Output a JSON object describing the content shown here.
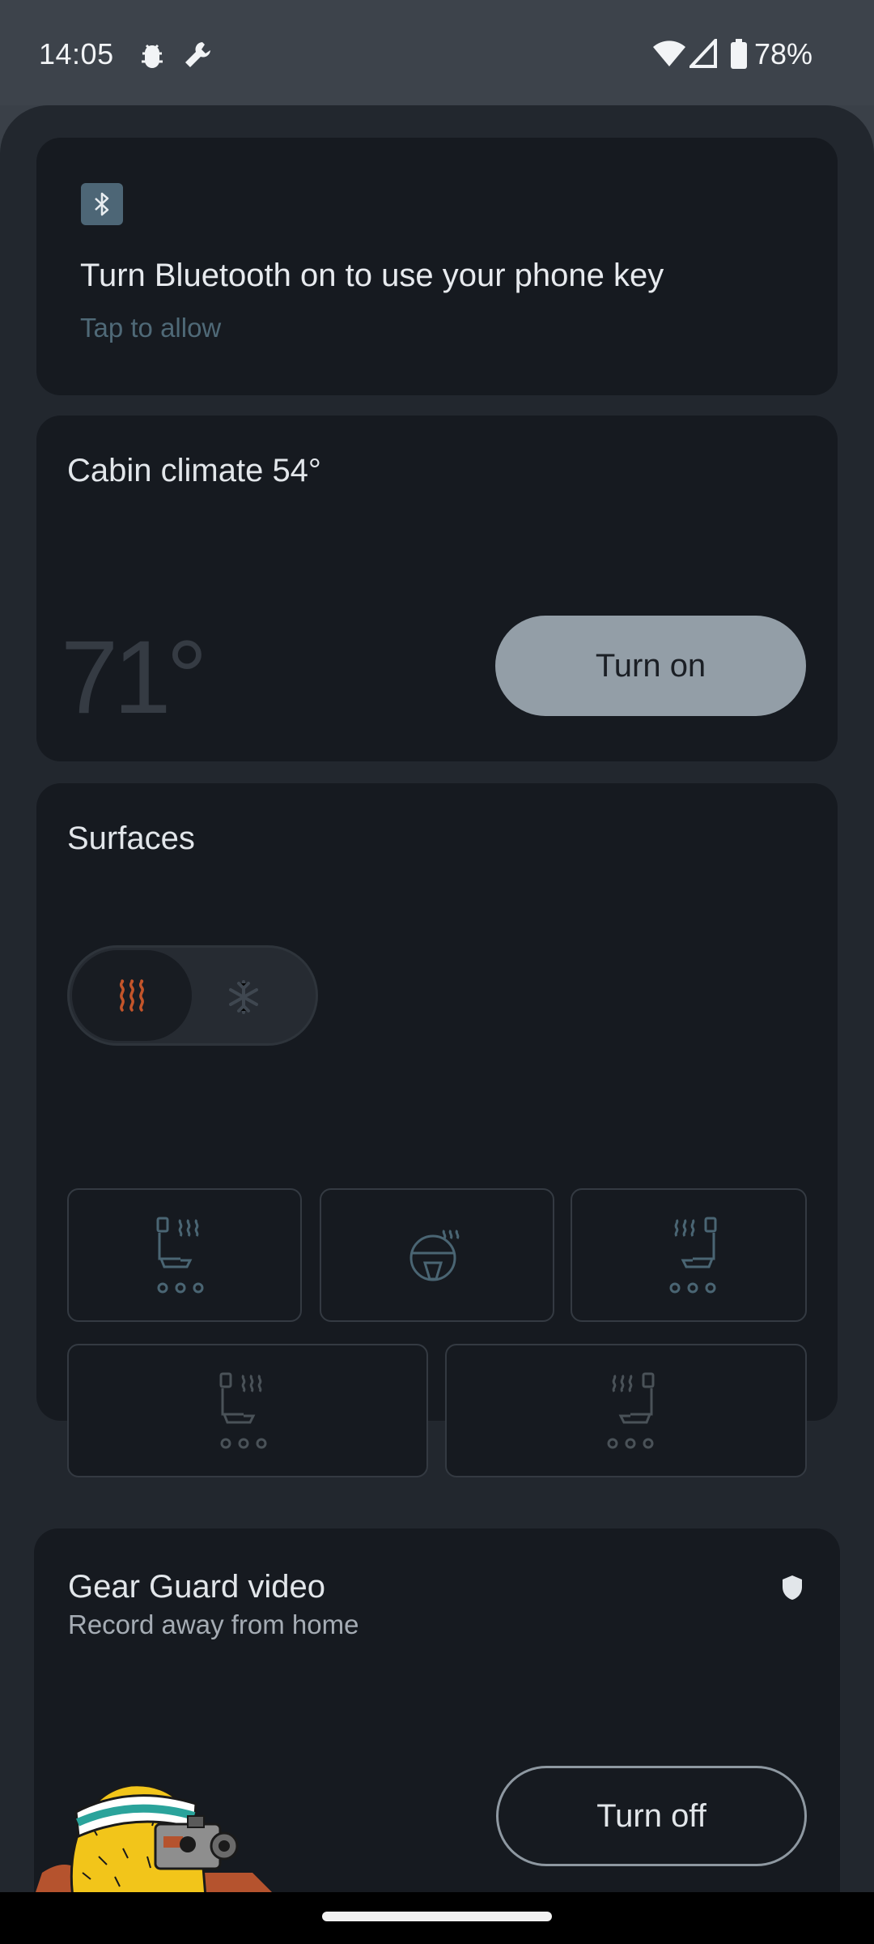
{
  "status_bar": {
    "time": "14:05",
    "battery": "78%"
  },
  "bluetooth_card": {
    "title": "Turn Bluetooth on to use your phone key",
    "subtitle": "Tap to allow"
  },
  "climate_card": {
    "title": "Cabin climate 54°",
    "set_temp": "71°",
    "button_label": "Turn on"
  },
  "surfaces_card": {
    "title": "Surfaces",
    "mode": "heat",
    "accent": "#c4552a",
    "seats": [
      "driver-seat",
      "steering-wheel",
      "passenger-seat",
      "rear-left-seat",
      "rear-right-seat"
    ]
  },
  "gear_guard_card": {
    "title": "Gear Guard video",
    "subtitle": "Record away from home",
    "button_label": "Turn off"
  }
}
